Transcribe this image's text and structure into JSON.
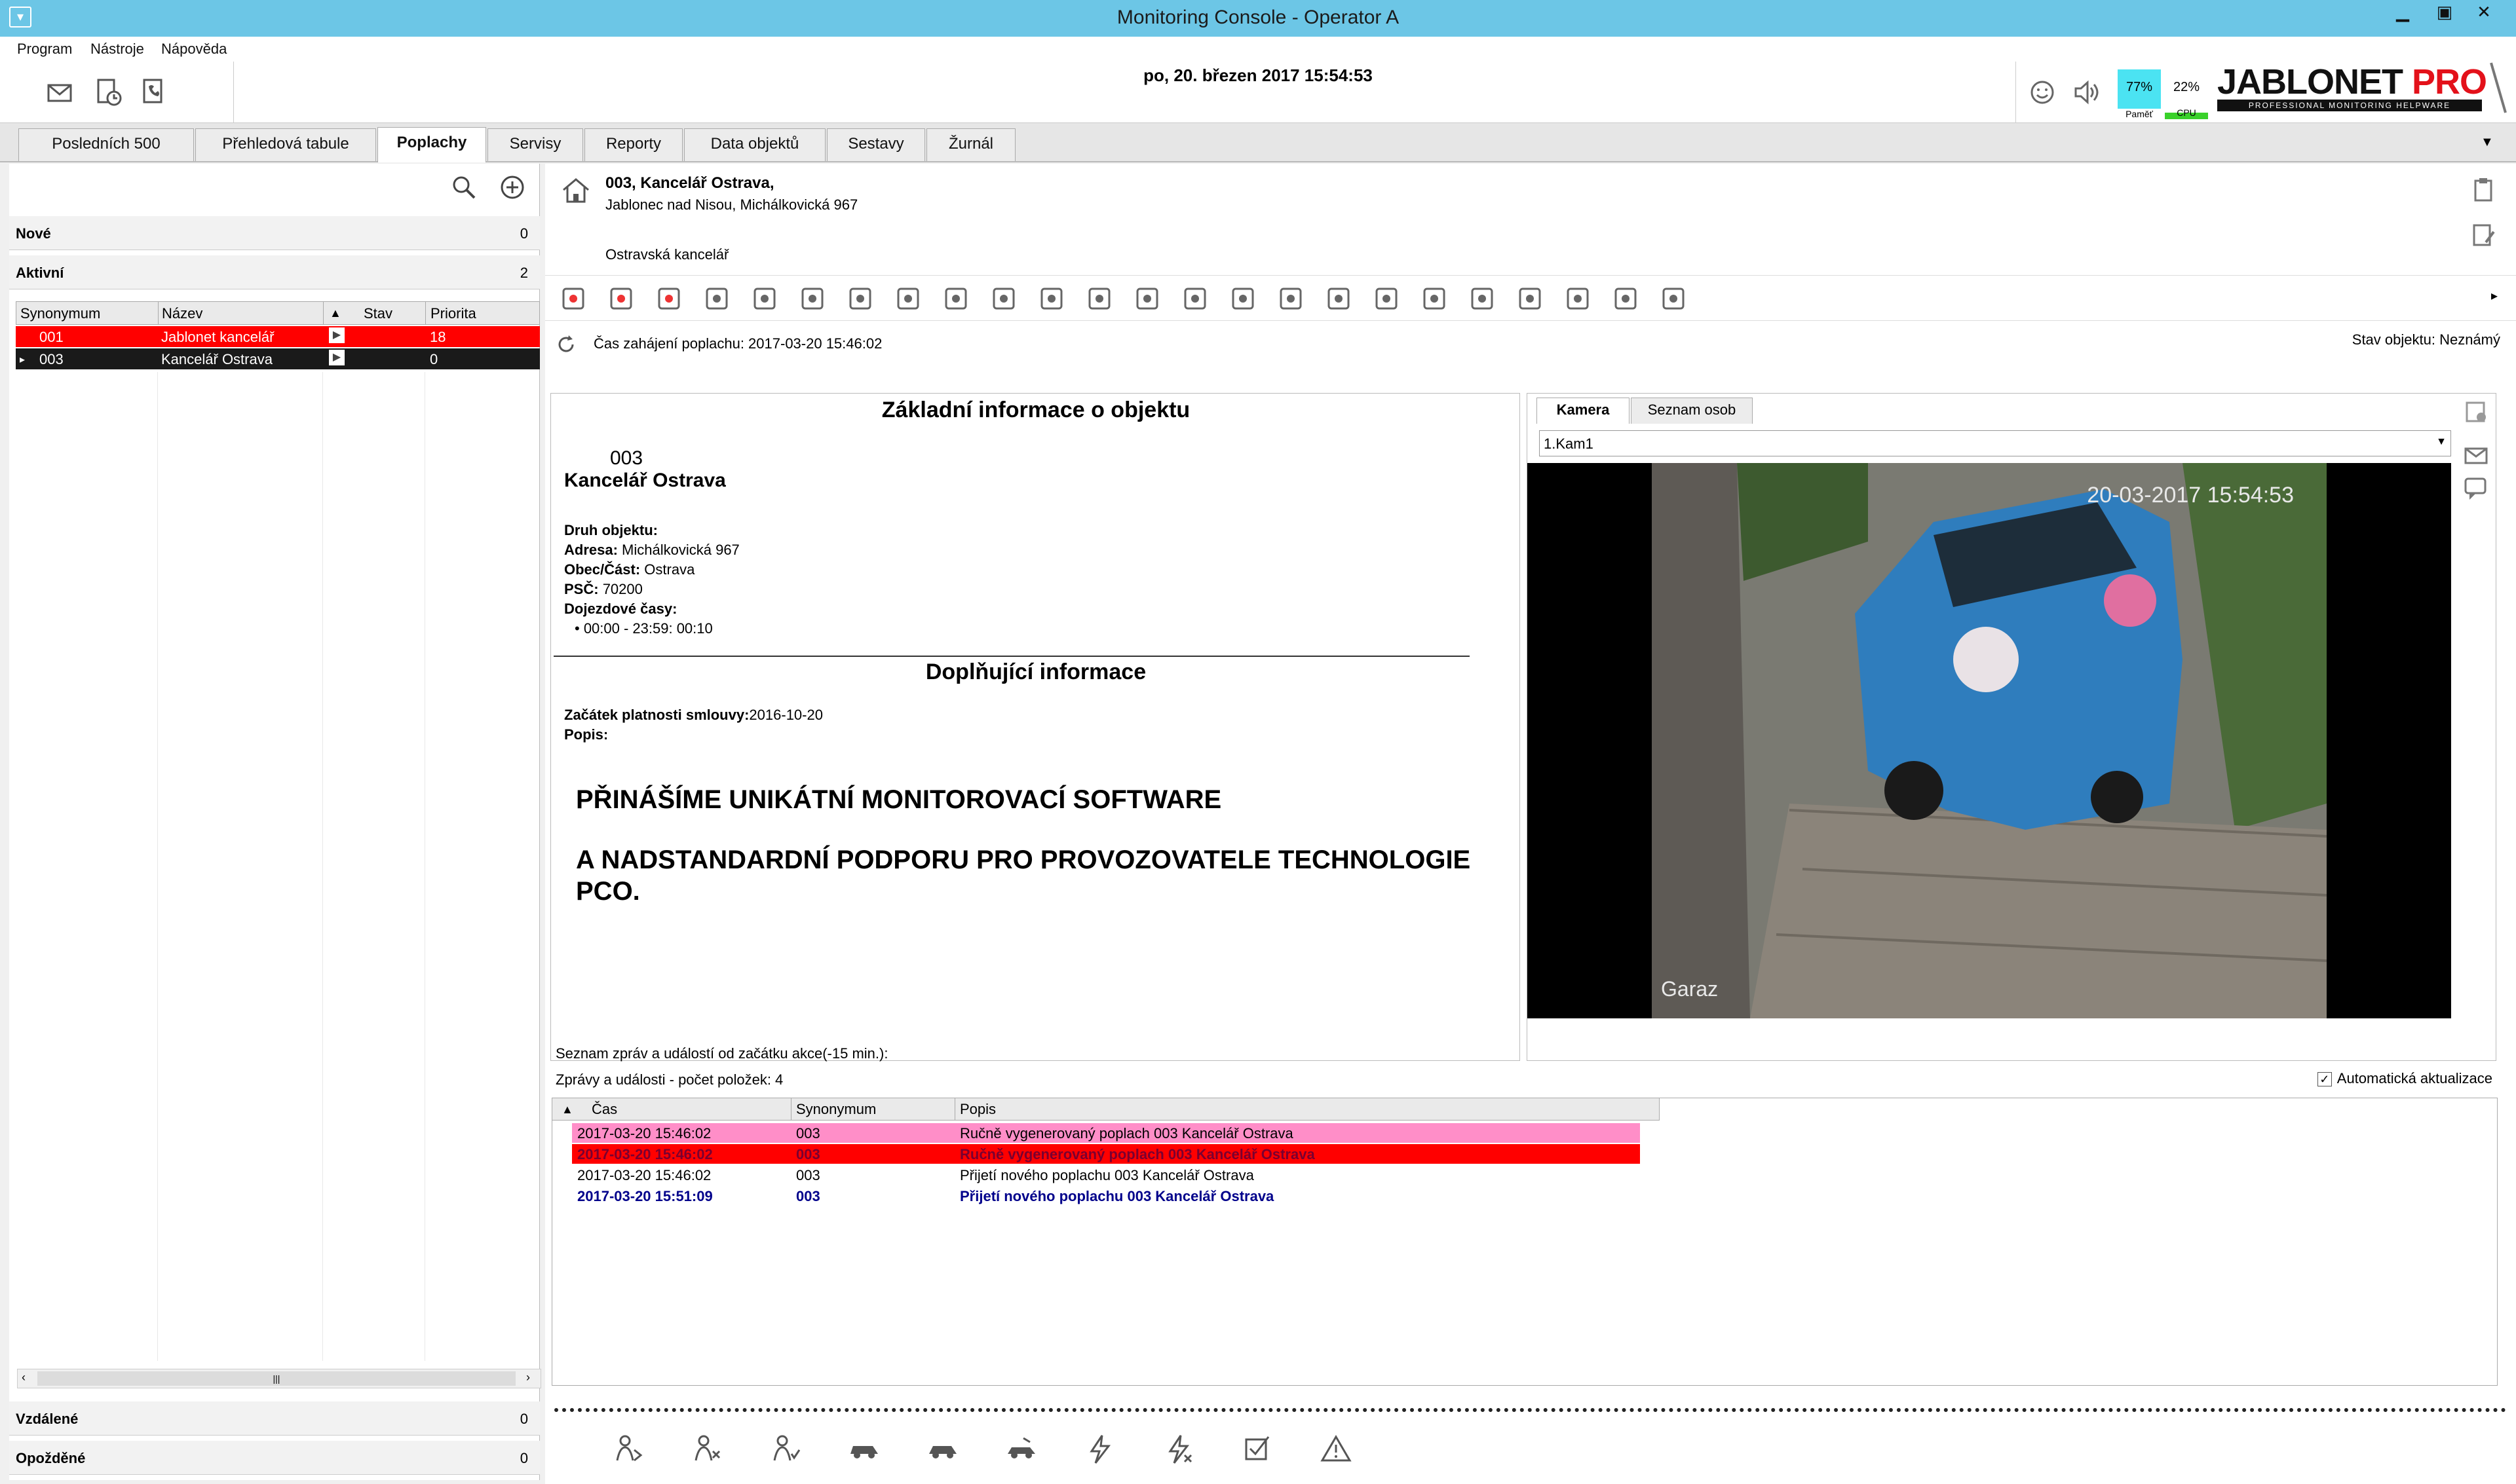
{
  "window": {
    "title": "Monitoring Console  - Operator A"
  },
  "menu": {
    "items": [
      "Program",
      "Nástroje",
      "Nápověda"
    ]
  },
  "toolbar": {
    "datetime": "po, 20. březen 2017 15:54:53",
    "mem": {
      "pct": "77%",
      "cap": "Paměť"
    },
    "cpu": {
      "pct": "22%",
      "cap": "CPU"
    }
  },
  "logo": {
    "main": "JABLONET",
    "pro": "PRO",
    "tagline": "PROFESSIONAL MONITORING HELPWARE"
  },
  "tabs": [
    {
      "label": "Posledních 500"
    },
    {
      "label": "Přehledová tabule"
    },
    {
      "label": "Poplachy"
    },
    {
      "label": "Servisy"
    },
    {
      "label": "Reporty"
    },
    {
      "label": "Data objektů"
    },
    {
      "label": "Sestavy"
    },
    {
      "label": "Žurnál"
    }
  ],
  "left": {
    "sections": {
      "nove": {
        "label": "Nové",
        "count": "0"
      },
      "aktivni": {
        "label": "Aktivní",
        "count": "2"
      },
      "vzdalene": {
        "label": "Vzdálené",
        "count": "0"
      },
      "opozdene": {
        "label": "Opožděné",
        "count": "0"
      }
    },
    "columns": [
      "Synonymum",
      "Název",
      "Stav",
      "Priorita"
    ],
    "rows": [
      {
        "synonym": "001",
        "name": "Jablonet kancelář",
        "priority": "18",
        "color": "#ff0000"
      },
      {
        "synonym": "003",
        "name": "Kancelář Ostrava",
        "priority": "0",
        "color": "#1a1a1a"
      }
    ]
  },
  "object": {
    "title": "003, Kancelář Ostrava,",
    "address": "Jablonec nad Nisou, Michálkovická 967",
    "note": "Ostravská kancelář",
    "alarm_start": "Čas zahájení poplachu: 2017-03-20 15:46:02",
    "state": "Stav objektu: Neznámý"
  },
  "info": {
    "heading1": "Základní informace o objektu",
    "number": "003",
    "name": "Kancelář Ostrava",
    "druh_label": "Druh objektu:",
    "adresa_label": "Adresa:",
    "adresa_value": "Michálkovická 967",
    "obec_label": "Obec/Část:",
    "obec_value": "Ostrava",
    "psc_label": "PSČ:",
    "psc_value": "70200",
    "dojezd_label": "Dojezdové časy:",
    "dojezd_value": "• 00:00 - 23:59: 00:10",
    "heading2": "Doplňující informace",
    "smlouva_label": "Začátek platnosti smlouvy:",
    "smlouva_value": "2016-10-20",
    "popis_label": "Popis:",
    "promo1": "PŘINÁŠÍME UNIKÁTNÍ MONITOROVACÍ SOFTWARE",
    "promo2": "A NADSTANDARDNÍ PODPORU PRO PROVOZOVATELE TECHNOLOGIE PCO."
  },
  "camera": {
    "tabs": [
      "Kamera",
      "Seznam osob"
    ],
    "selected": "1.Kam1",
    "timestamp": "20-03-2017 15:54:53",
    "label": "Garaz"
  },
  "messages": {
    "title": "Seznam zpráv a událostí od začátku akce(-15 min.):",
    "count": "Zprávy a události - počet položek: 4",
    "auto_update": "Automatická aktualizace",
    "columns": [
      "Čas",
      "Synonymum",
      "Popis"
    ],
    "rows": [
      {
        "time": "2017-03-20 15:46:02",
        "synonym": "003",
        "desc": "Ručně vygenerovaný poplach 003 Kancelář Ostrava",
        "bg": "#ff8ec8",
        "fg": "#000000",
        "bold": false
      },
      {
        "time": "2017-03-20 15:46:02",
        "synonym": "003",
        "desc": "Ručně vygenerovaný poplach 003 Kancelář Ostrava",
        "bg": "#ff0000",
        "fg": "#7a0030",
        "bold": true
      },
      {
        "time": "2017-03-20 15:46:02",
        "synonym": "003",
        "desc": "Přijetí nového poplachu 003 Kancelář Ostrava",
        "bg": "#ffffff",
        "fg": "#000000",
        "bold": false
      },
      {
        "time": "2017-03-20 15:51:09",
        "synonym": "003",
        "desc": "Přijetí nového poplachu 003 Kancelář Ostrava",
        "bg": "#ffffff",
        "fg": "#00008b",
        "bold": true
      }
    ]
  }
}
